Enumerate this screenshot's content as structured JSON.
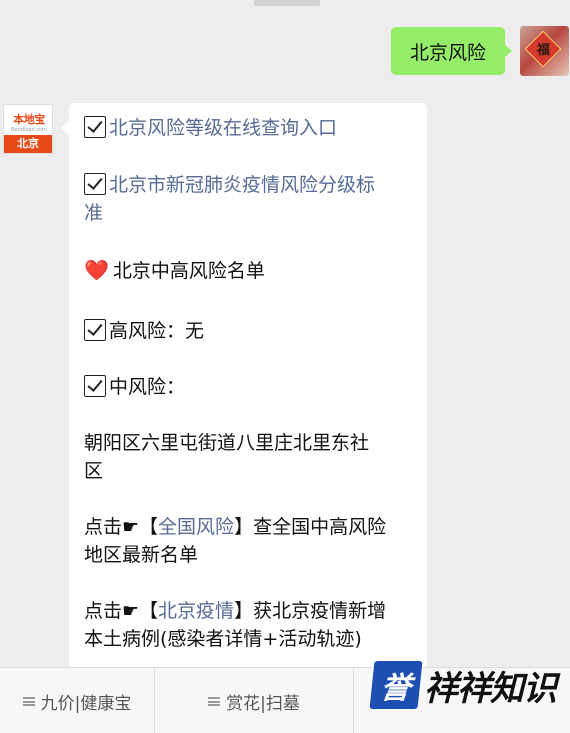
{
  "outgoing": {
    "text": "北京风险",
    "avatar_char": "福"
  },
  "bot": {
    "logo_text": "本地宝",
    "logo_url": "Bendibao.com",
    "logo_city": "北京"
  },
  "reply": {
    "link1": "北京风险等级在线查询入口",
    "link2_line1": "北京市新冠肺炎疫情风险分级标",
    "link2_line2": "准",
    "heart": "❤️",
    "list_title": "北京中高风险名单",
    "high_risk": "高风险：无",
    "mid_risk": "中风险：",
    "area_line1": "朝阳区六里屯街道八里庄北里东社",
    "area_line2": "区",
    "national_prefix": "点击☛【",
    "national_link": "全国风险",
    "national_suffix": "】查全国中高风险",
    "national_line2": "地区最新名单",
    "beijing_prefix": "点击☛【",
    "beijing_link": "北京疫情",
    "beijing_suffix": "】获北京疫情新增",
    "beijing_line2": "本土病例(感染者详情+活动轨迹)"
  },
  "menu": [
    {
      "label": "九价|健康宝"
    },
    {
      "label": "赏花|扫墓"
    }
  ],
  "watermark": {
    "box_char": "誉",
    "text": "祥祥知识"
  }
}
